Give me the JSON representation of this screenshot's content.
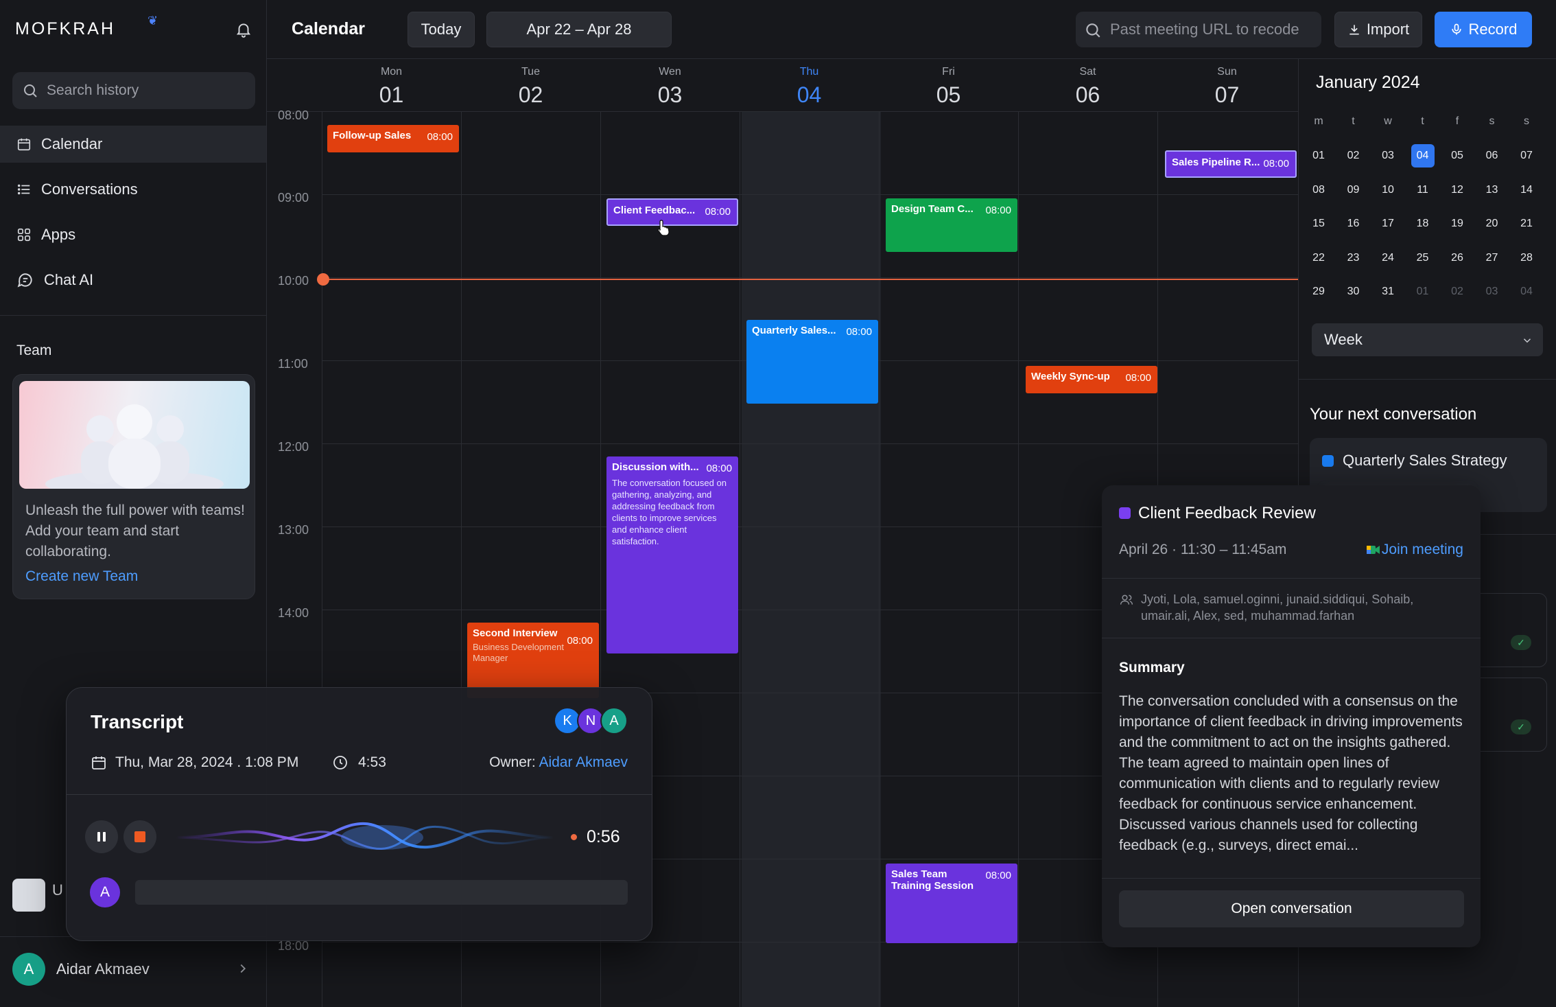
{
  "sidebar": {
    "logo": "MOFKRAH",
    "search_placeholder": "Search history",
    "nav": [
      {
        "label": "Calendar",
        "icon": "calendar-icon",
        "active": true
      },
      {
        "label": "Conversations",
        "icon": "list-icon",
        "active": false
      },
      {
        "label": "Apps",
        "icon": "grid-icon",
        "active": false
      },
      {
        "label": "Chat AI",
        "icon": "chat-icon",
        "active": false
      }
    ],
    "team": {
      "title": "Team",
      "text": "Unleash the full power with teams! Add your team and start collaborating.",
      "link": "Create new Team"
    },
    "misc_initial": "U",
    "user": {
      "initial": "A",
      "name": "Aidar Akmaev"
    }
  },
  "header": {
    "title": "Calendar",
    "today_label": "Today",
    "range_label": "Apr 22 – Apr 28",
    "url_placeholder": "Past meeting URL to recode",
    "import_label": "Import",
    "record_label": "Record"
  },
  "calendar": {
    "days": [
      {
        "name": "Mon",
        "num": "01"
      },
      {
        "name": "Tue",
        "num": "02"
      },
      {
        "name": "Wen",
        "num": "03"
      },
      {
        "name": "Thu",
        "num": "04",
        "today": true
      },
      {
        "name": "Fri",
        "num": "05"
      },
      {
        "name": "Sat",
        "num": "06"
      },
      {
        "name": "Sun",
        "num": "07"
      }
    ],
    "times": [
      "08:00",
      "09:00",
      "10:00",
      "11:00",
      "12:00",
      "13:00",
      "14:00",
      "18:00"
    ],
    "events": [
      {
        "title": "Follow-up Sales",
        "time": "08:00",
        "color": "#e1400f"
      },
      {
        "title": "Client Feedbac...",
        "time": "08:00",
        "color": "#6a33dd",
        "selected": true
      },
      {
        "title": "Design Team C...",
        "time": "08:00",
        "color": "#0ea34c"
      },
      {
        "title": "Sales Pipeline R...",
        "time": "08:00",
        "color": "#6a33dd"
      },
      {
        "title": "Quarterly Sales...",
        "time": "08:00",
        "color": "#0a80f0"
      },
      {
        "title": "Weekly Sync-up",
        "time": "08:00",
        "color": "#e1400f"
      },
      {
        "title": "Discussion with...",
        "time": "08:00",
        "color": "#6a33dd",
        "description": "The conversation focused on gathering, analyzing, and addressing feedback from clients to improve services and enhance client satisfaction."
      },
      {
        "title": "Second Interview",
        "time": "08:00",
        "color": "#e1400f",
        "subtitle": "Business Development Manager"
      },
      {
        "title": "Sales Team Training Session",
        "time": "08:00",
        "color": "#6a33dd"
      }
    ]
  },
  "mini_calendar": {
    "month": "January 2024",
    "dow": [
      "m",
      "t",
      "w",
      "t",
      "f",
      "s",
      "s"
    ],
    "weeks": [
      [
        "01",
        "02",
        "03",
        "04",
        "05",
        "06",
        "07"
      ],
      [
        "08",
        "09",
        "10",
        "11",
        "12",
        "13",
        "14"
      ],
      [
        "15",
        "16",
        "17",
        "18",
        "19",
        "20",
        "21"
      ],
      [
        "22",
        "23",
        "24",
        "25",
        "26",
        "27",
        "28"
      ],
      [
        "29",
        "30",
        "31",
        "01",
        "02",
        "03",
        "04"
      ]
    ],
    "selected": "04",
    "view_label": "Week"
  },
  "next_conversation": {
    "title": "Your next conversation",
    "name": "Quarterly Sales Strategy"
  },
  "popup": {
    "title": "Client Feedback Review",
    "date": "April 26 · 11:30 – 11:45am",
    "join_label": "Join meeting",
    "people": "Jyoti, Lola, samuel.oginni, junaid.siddiqui, Sohaib, umair.ali, Alex, sed, muhammad.farhan",
    "summary_title": "Summary",
    "summary": "The conversation concluded with a consensus on the importance of client feedback in driving improvements and the commitment to act on the insights gathered. The team agreed to maintain open lines of communication with clients and to regularly review feedback for continuous service enhancement. Discussed various channels used for collecting feedback (e.g., surveys, direct emai...",
    "open_label": "Open conversation",
    "accent": "#7a3ff0"
  },
  "transcript": {
    "title": "Transcript",
    "date": "Thu, Mar 28, 2024 . 1:08 PM",
    "duration": "4:53",
    "owner_label": "Owner:",
    "owner": "Aidar Akmaev",
    "elapsed": "0:56",
    "participants": [
      {
        "initial": "K",
        "color": "#1a7cf0"
      },
      {
        "initial": "N",
        "color": "#6a33dd"
      },
      {
        "initial": "A",
        "color": "#17a088"
      }
    ],
    "speaker_initial": "A"
  }
}
